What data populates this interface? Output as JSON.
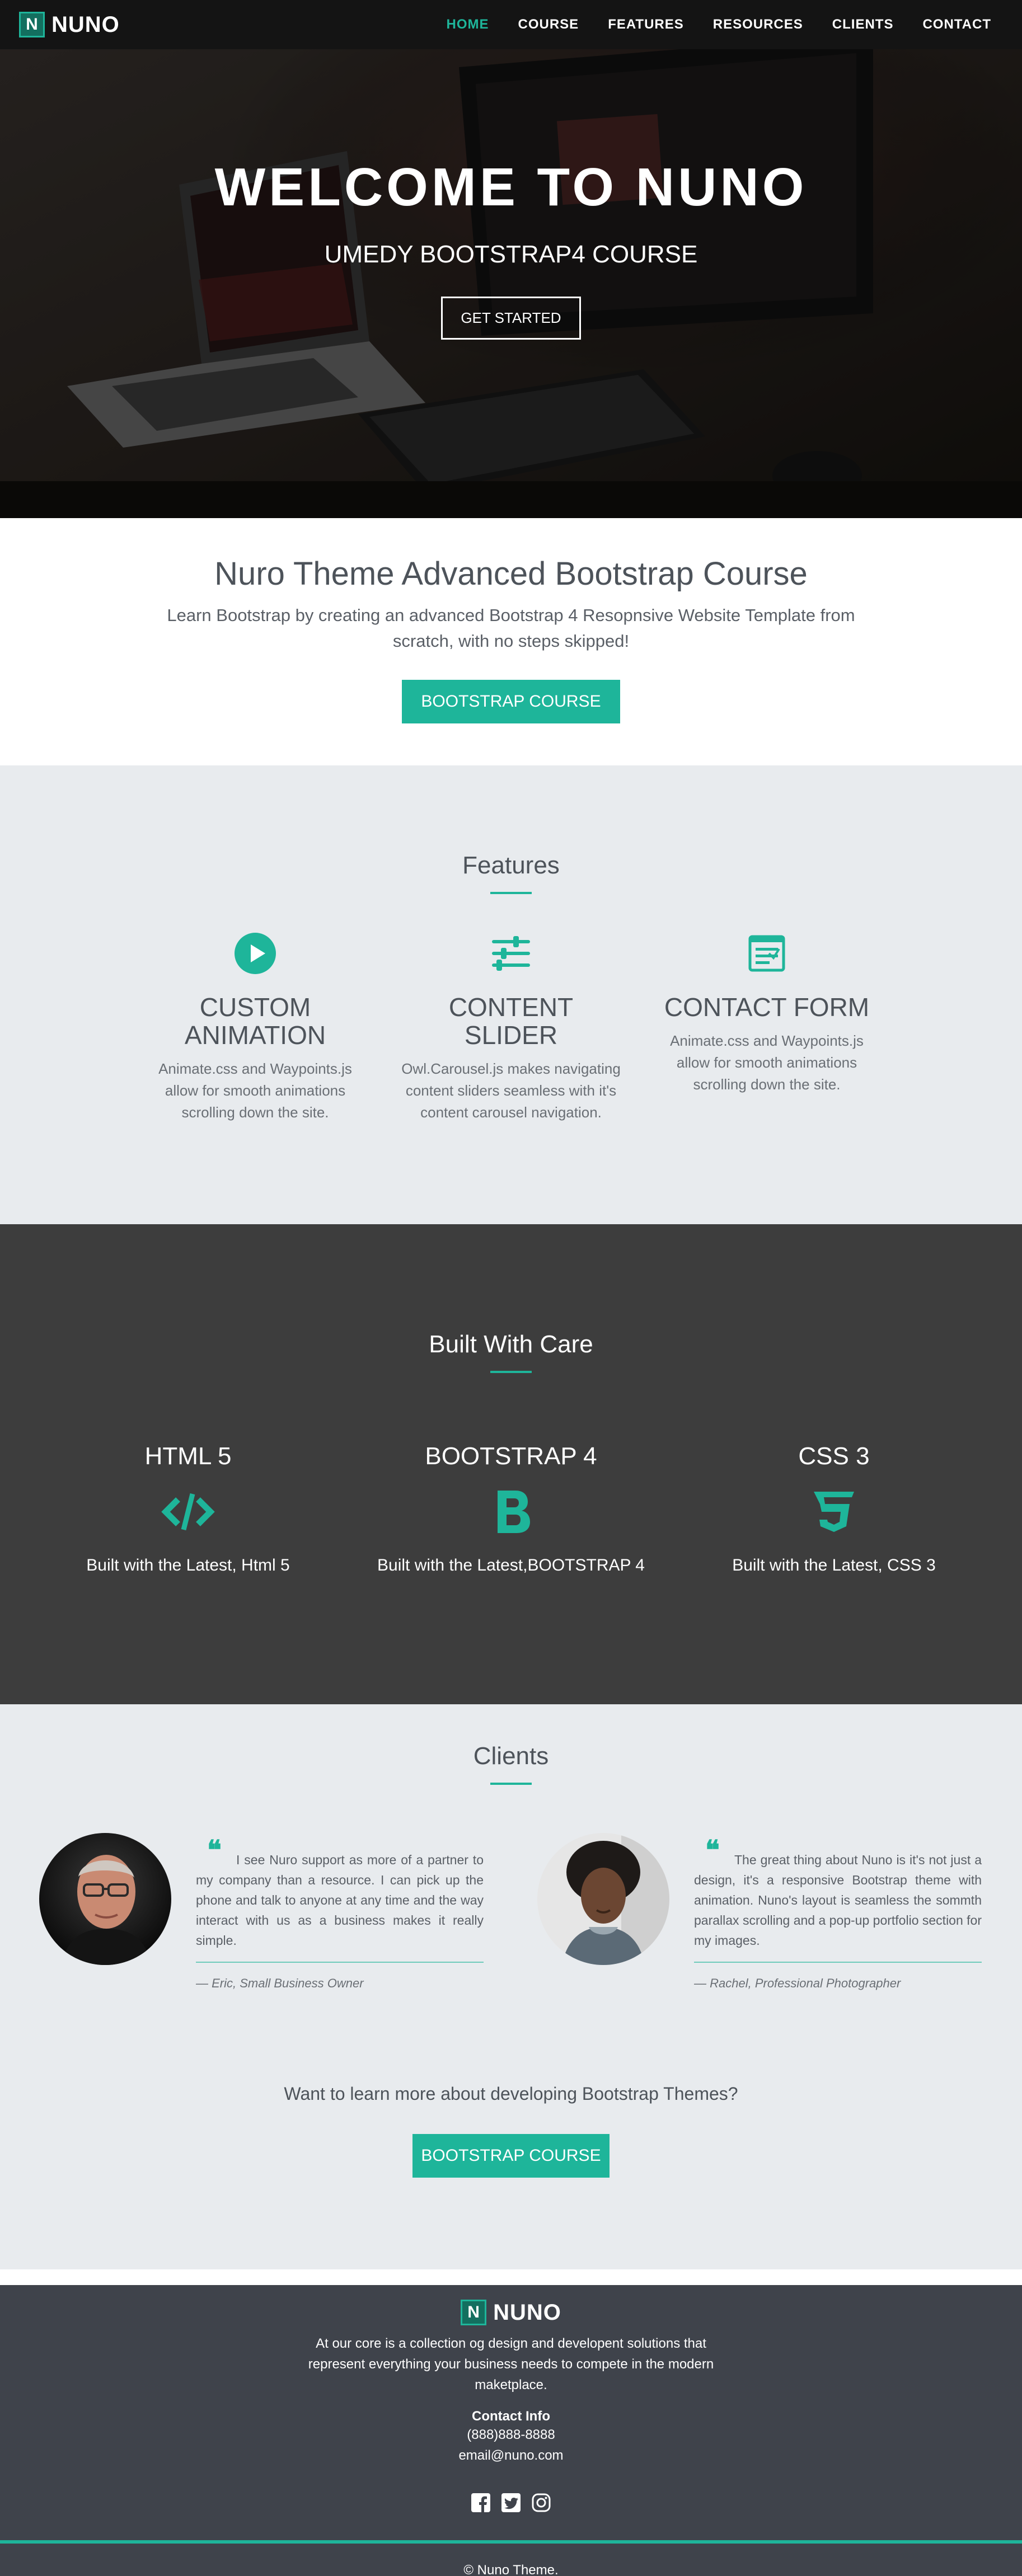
{
  "nav": {
    "brand_letter": "N",
    "brand_name": "NUNO",
    "items": [
      {
        "label": "HOME",
        "active": true
      },
      {
        "label": "COURSE",
        "active": false
      },
      {
        "label": "FEATURES",
        "active": false
      },
      {
        "label": "RESOURCES",
        "active": false
      },
      {
        "label": "CLIENTS",
        "active": false
      },
      {
        "label": "CONTACT",
        "active": false
      }
    ]
  },
  "hero": {
    "title": "WELCOME TO NUNO",
    "subtitle": "UMEDY BOOTSTRAP4 COURSE",
    "button": "GET STARTED"
  },
  "intro": {
    "title": "Nuro Theme Advanced Bootstrap Course",
    "text": "Learn Bootstrap by creating an advanced Bootstrap 4 Resopnsive Website Template from scratch, with no steps skipped!",
    "button": "BOOTSTRAP COURSE"
  },
  "features": {
    "title": "Features",
    "items": [
      {
        "icon": "play-circle-icon",
        "title": "CUSTOM ANIMATION",
        "text": "Animate.css and Waypoints.js allow for smooth animations scrolling down the site."
      },
      {
        "icon": "sliders-icon",
        "title": "CONTENT SLIDER",
        "text": "Owl.Carousel.js makes navigating content sliders seamless with it's content carousel navigation."
      },
      {
        "icon": "form-icon",
        "title": "CONTACT FORM",
        "text": "Animate.css and Waypoints.js allow for smooth animations scrolling down the site."
      }
    ]
  },
  "built": {
    "title": "Built With Care",
    "items": [
      {
        "icon": "code-icon",
        "title": "HTML 5",
        "text": "Built with the Latest, Html 5"
      },
      {
        "icon": "bootstrap-icon",
        "title": "BOOTSTRAP 4",
        "text": "Built with the Latest,BOOTSTRAP 4"
      },
      {
        "icon": "css3-icon",
        "title": "CSS 3",
        "text": "Built with the Latest, CSS 3"
      }
    ]
  },
  "clients": {
    "title": "Clients",
    "testimonials": [
      {
        "quote_mark": "❝",
        "text": "I see Nuro support as more of a partner to my company than a resource. I can pick up the phone and talk to anyone at any time and the way interact with us as a business makes it really simple.",
        "author": "— Eric, Small Business Owner"
      },
      {
        "quote_mark": "❝",
        "text": "The great thing about Nuno is it's not just a design, it's a responsive Bootstrap theme with animation. Nuno's layout is seamless the sommth parallax scrolling and a pop-up portfolio section for my images.",
        "author": "— Rachel, Professional Photographer"
      }
    ],
    "cta_text": "Want to learn more about developing Bootstrap Themes?",
    "cta_button": "BOOTSTRAP COURSE"
  },
  "footer": {
    "brand_letter": "N",
    "brand_name": "NUNO",
    "description": "At our core is a collection og design and developent solutions that represent everything your business needs to compete in the modern maketplace.",
    "contact_title": "Contact Info",
    "phone": "(888)888-8888",
    "email": "email@nuno.com",
    "socials": [
      "facebook-icon",
      "twitter-icon",
      "instagram-icon"
    ],
    "copyright": "© Nuno Theme."
  },
  "colors": {
    "accent": "#1eb59a",
    "dark_section": "#3d3d3d",
    "light_section": "#e8ebee",
    "footer": "#3f434b",
    "nav": "#141414"
  }
}
